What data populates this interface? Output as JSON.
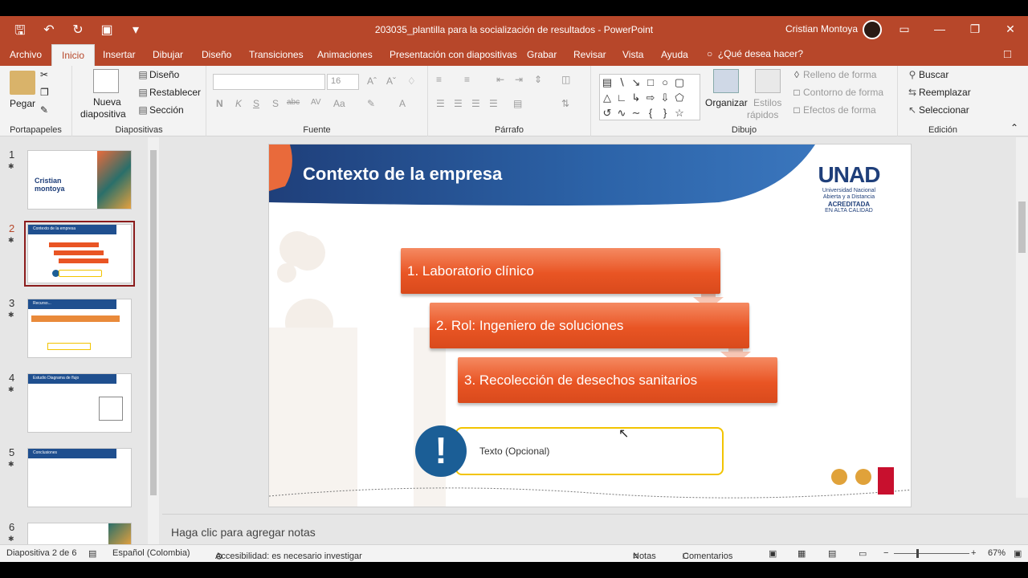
{
  "window": {
    "title": "203035_plantilla para la socialización de resultados - PowerPoint",
    "user": "Cristian Montoya"
  },
  "tabs": [
    "Archivo",
    "Inicio",
    "Insertar",
    "Dibujar",
    "Diseño",
    "Transiciones",
    "Animaciones",
    "Presentación con diapositivas",
    "Grabar",
    "Revisar",
    "Vista",
    "Ayuda"
  ],
  "active_tab": "Inicio",
  "tellme": "¿Qué desea hacer?",
  "ribbon": {
    "portapapeles": {
      "label": "Portapapeles",
      "pegar": "Pegar"
    },
    "diapositivas": {
      "label": "Diapositivas",
      "nueva": "Nueva",
      "nueva2": "diapositiva",
      "diseno": "Diseño",
      "restablecer": "Restablecer",
      "seccion": "Sección"
    },
    "fuente": {
      "label": "Fuente",
      "size": "16",
      "bold": "N",
      "italic": "K",
      "underline": "S",
      "shadow": "S",
      "strike": "abc",
      "spacing": "AV",
      "case": "Aa"
    },
    "parrafo": {
      "label": "Párrafo"
    },
    "dibujo": {
      "label": "Dibujo",
      "organizar": "Organizar",
      "estilos": "Estilos",
      "rapidos": "rápidos",
      "relleno": "Relleno de forma",
      "contorno": "Contorno de forma",
      "efectos": "Efectos de forma"
    },
    "edicion": {
      "label": "Edición",
      "buscar": "Buscar",
      "reemplazar": "Reemplazar",
      "seleccionar": "Seleccionar"
    }
  },
  "slides": [
    {
      "num": "1",
      "title_a": "Cristian",
      "title_b": "montoya"
    },
    {
      "num": "2",
      "title": "Contexto de la empresa"
    },
    {
      "num": "3",
      "title": "Recurso..."
    },
    {
      "num": "4",
      "title": "Estudio  Diagrama de flujo"
    },
    {
      "num": "5",
      "title": "Conclusiones"
    },
    {
      "num": "6"
    }
  ],
  "current_slide": {
    "title": "Contexto de la empresa",
    "steps": [
      "1. Laboratorio clínico",
      "2. Rol: Ingeniero de soluciones",
      "3. Recolección de desechos sanitarios"
    ],
    "optional_text": "Texto (Opcional)",
    "logo": {
      "name": "UNAD",
      "line1": "Universidad Nacional",
      "line2": "Abierta y a Distancia",
      "line3": "ACREDITADA",
      "line4": "EN ALTA CALIDAD"
    }
  },
  "notes_placeholder": "Haga clic para agregar notas",
  "status": {
    "slide_info": "Diapositiva 2 de 6",
    "language": "Español (Colombia)",
    "accessibility": "Accesibilidad: es necesario investigar",
    "notes": "Notas",
    "comments": "Comentarios",
    "zoom": "67%"
  },
  "colors": {
    "accent": "#b7472a",
    "step": "#e95524",
    "title_band": "#1f4f8f",
    "exclaim": "#1b5e96",
    "opt_border": "#f2c400"
  }
}
